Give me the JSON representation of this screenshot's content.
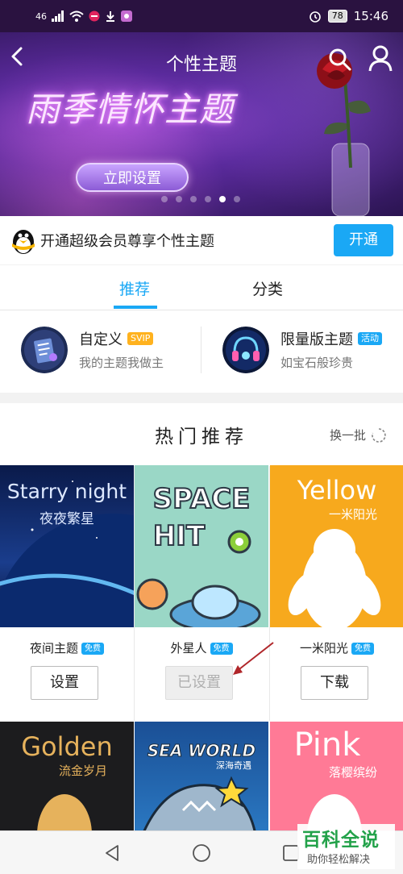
{
  "status_bar": {
    "signal": "46",
    "battery": "78",
    "time": "15:46"
  },
  "header": {
    "title": "个性主题"
  },
  "banner": {
    "theme_name": "雨季情怀主题",
    "button_label": "立即设置",
    "dot_count": 6,
    "active_dot": 5
  },
  "vip": {
    "text": "开通超级会员尊享个性主题",
    "button_label": "开通"
  },
  "tabs": [
    {
      "label": "推荐",
      "active": true
    },
    {
      "label": "分类",
      "active": false
    }
  ],
  "features": [
    {
      "title": "自定义",
      "badge": "SVIP",
      "subtitle": "我的主题我做主"
    },
    {
      "title": "限量版主题",
      "badge": "活动",
      "subtitle": "如宝石般珍贵"
    }
  ],
  "hot": {
    "title": "热门推荐",
    "refresh_label": "换一批",
    "cards": [
      {
        "en": "Starry night",
        "zh": "夜夜繁星",
        "name": "夜间主题",
        "badge": "免费",
        "button": "设置",
        "disabled": false
      },
      {
        "en1": "SPACE",
        "en2": "HIT",
        "name": "外星人",
        "badge": "免费",
        "button": "已设置",
        "disabled": true
      },
      {
        "en": "Yellow",
        "zh": "一米阳光",
        "name": "一米阳光",
        "badge": "免费",
        "button": "下载",
        "disabled": false
      },
      {
        "en": "Golden",
        "zh": "流金岁月"
      },
      {
        "en": "SEA WORLD",
        "zh": "深海奇遇"
      },
      {
        "en": "Pink",
        "zh": "落樱缤纷"
      }
    ]
  },
  "watermark": {
    "main": "百科全说",
    "sub": "助你轻松解决"
  },
  "colors": {
    "accent": "#1aa8f5",
    "svip": "#ffb21e",
    "watermark_green": "#23a24a"
  }
}
